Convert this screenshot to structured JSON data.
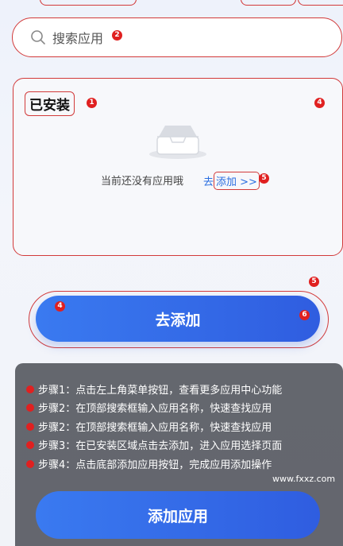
{
  "search": {
    "placeholder": "搜索应用",
    "badge": "2"
  },
  "installed": {
    "title": "已安装",
    "title_badge": "1",
    "card_badge": "4",
    "empty_text": "当前还没有应用哦",
    "add_prefix": "去",
    "add_link": "添加 >>",
    "link_badge": "5"
  },
  "go_add_button": {
    "label": "去添加",
    "frame_badge": "5",
    "left_badge": "4",
    "right_badge": "6"
  },
  "steps": [
    {
      "badge": "1",
      "text": "步骤1：点击左上角菜单按钮，查看更多应用中心功能"
    },
    {
      "badge": "2",
      "text": "步骤2：在顶部搜索框输入应用名称，快速查找应用"
    },
    {
      "badge": "2",
      "text": "步骤2：在顶部搜索框输入应用名称，快速查找应用"
    },
    {
      "badge": "3",
      "text": "步骤3：在已安装区域点击去添加，进入应用选择页面"
    },
    {
      "badge": "4",
      "text": "步骤4：点击底部添加应用按钮，完成应用添加操作"
    }
  ],
  "watermark": "www.fxxz.com",
  "add_app_button": {
    "label": "添加应用"
  },
  "colors": {
    "accent": "#3a7af0",
    "annotation_red": "#d23a3a",
    "badge_red": "#e02020",
    "overlay": "#585a62"
  }
}
